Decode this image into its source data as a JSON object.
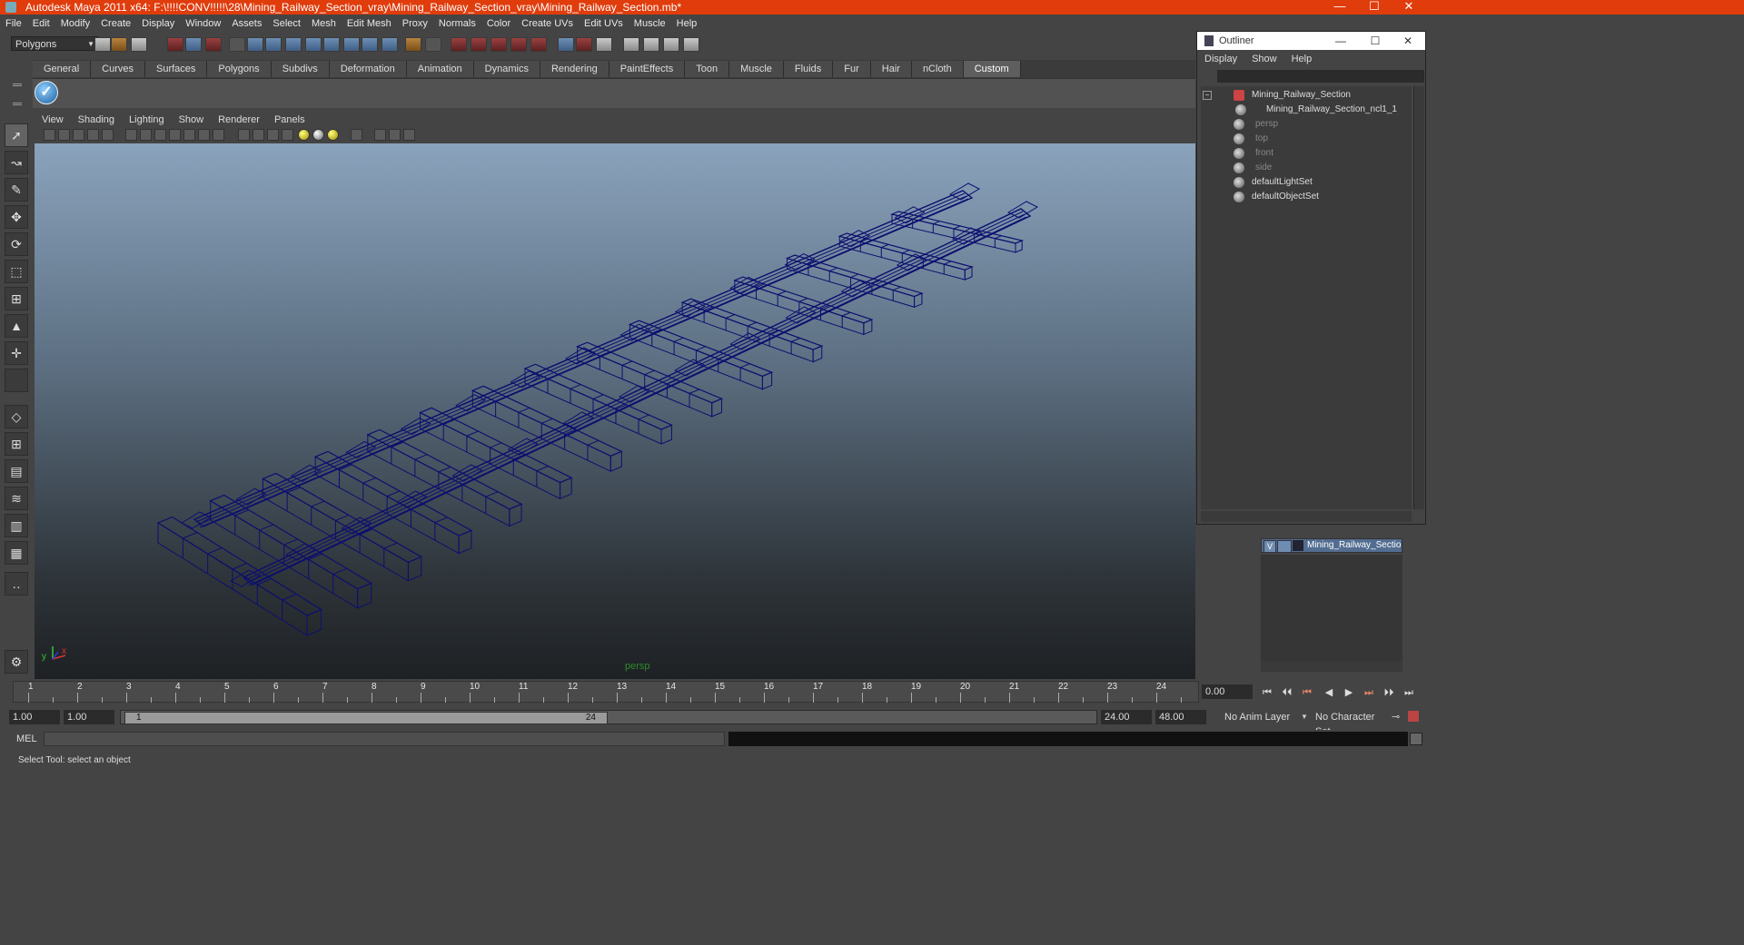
{
  "window": {
    "title": "Autodesk Maya 2011 x64: F:\\!!!!CONV!!!!!\\28\\Mining_Railway_Section_vray\\Mining_Railway_Section_vray\\Mining_Railway_Section.mb*",
    "minimize": "—",
    "maximize": "☐",
    "close": "✕"
  },
  "menubar": [
    "File",
    "Edit",
    "Modify",
    "Create",
    "Display",
    "Window",
    "Assets",
    "Select",
    "Mesh",
    "Edit Mesh",
    "Proxy",
    "Normals",
    "Color",
    "Create UVs",
    "Edit UVs",
    "Muscle",
    "Help"
  ],
  "statusline": {
    "mode": "Polygons"
  },
  "shelf": {
    "tabs": [
      "General",
      "Curves",
      "Surfaces",
      "Polygons",
      "Subdivs",
      "Deformation",
      "Animation",
      "Dynamics",
      "Rendering",
      "PaintEffects",
      "Toon",
      "Muscle",
      "Fluids",
      "Fur",
      "Hair",
      "nCloth",
      "Custom"
    ],
    "active_tab": "Custom",
    "check_icon": "✓"
  },
  "viewport": {
    "menu": [
      "View",
      "Shading",
      "Lighting",
      "Show",
      "Renderer",
      "Panels"
    ],
    "camera_label": "persp",
    "axis_y": "y",
    "axis_x": "x",
    "wire_color": "#0d0f6e"
  },
  "outliner": {
    "title": "Outliner",
    "menu": [
      "Display",
      "Show",
      "Help"
    ],
    "items": [
      {
        "label": "Mining_Railway_Section",
        "dim": false
      },
      {
        "label": "Mining_Railway_Section_ncl1_1",
        "dim": false
      },
      {
        "label": "persp",
        "dim": true
      },
      {
        "label": "top",
        "dim": true
      },
      {
        "label": "front",
        "dim": true
      },
      {
        "label": "side",
        "dim": true
      },
      {
        "label": "defaultLightSet",
        "dim": false
      },
      {
        "label": "defaultObjectSet",
        "dim": false
      }
    ]
  },
  "layer": {
    "visible": "V",
    "name": "Mining_Railway_Section_"
  },
  "timeline": {
    "ticks": [
      "1",
      "2",
      "3",
      "4",
      "5",
      "6",
      "7",
      "8",
      "9",
      "10",
      "11",
      "12",
      "13",
      "14",
      "15",
      "16",
      "17",
      "18",
      "19",
      "20",
      "21",
      "22",
      "23",
      "24"
    ],
    "current_time": "0.00"
  },
  "range": {
    "start": "1.00",
    "playback_start": "1.00",
    "handle_left": "1",
    "handle_right": "24",
    "playback_end": "24.00",
    "end": "48.00",
    "anim_layer": "No Anim Layer",
    "character_set": "No Character Set"
  },
  "command": {
    "label": "MEL"
  },
  "help": {
    "text": "Select Tool: select an object"
  }
}
